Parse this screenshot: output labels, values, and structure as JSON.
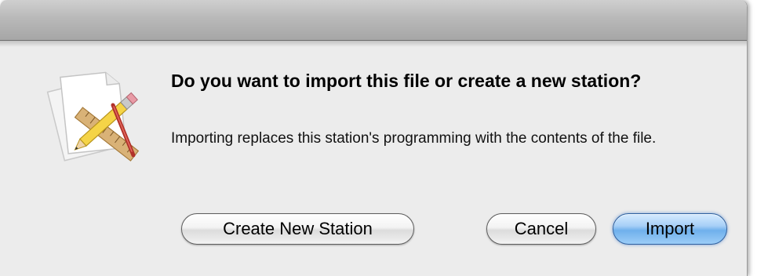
{
  "dialog": {
    "heading": "Do you want to import this file or create a new station?",
    "message": "Importing replaces this station's programming with the contents of the file.",
    "icon": "document-pencil-ruler-icon"
  },
  "buttons": {
    "create_label": "Create New Station",
    "cancel_label": "Cancel",
    "import_label": "Import"
  },
  "colors": {
    "sheet_background": "#ececec",
    "default_button": "#6fb0ec",
    "titlebar": "#b9b9b9"
  }
}
